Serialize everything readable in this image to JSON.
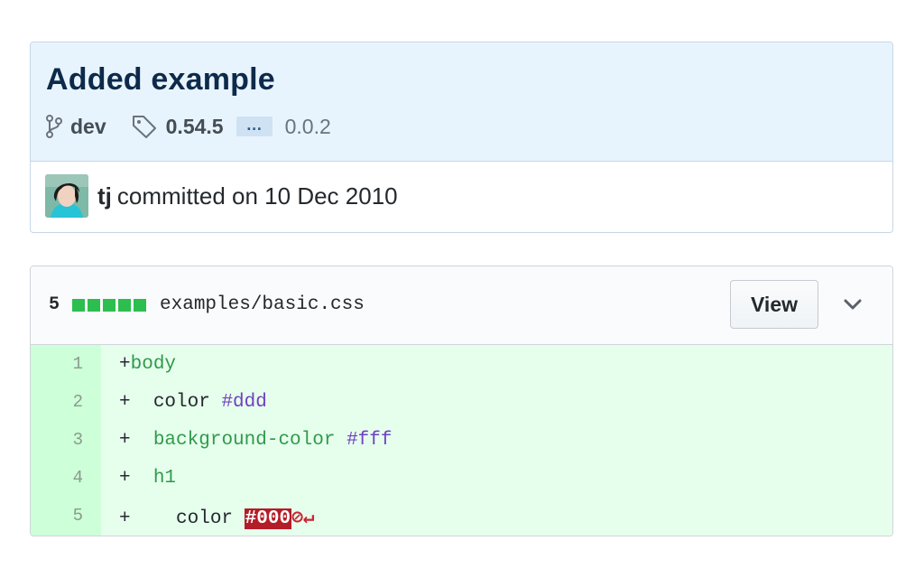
{
  "commit": {
    "title": "Added example",
    "branch": "dev",
    "tag_start": "0.54.5",
    "tag_ellipsis": "…",
    "tag_end": "0.0.2",
    "author": "tj",
    "committed_text": "committed on 10 Dec 2010"
  },
  "file": {
    "additions": "5",
    "diffstat_blocks": 5,
    "path": "examples/basic.css",
    "view_label": "View"
  },
  "diff": {
    "lines": [
      {
        "num": "1",
        "sign": "+",
        "tokens": [
          {
            "t": "body",
            "c": "green"
          }
        ]
      },
      {
        "num": "2",
        "sign": "+",
        "tokens": [
          {
            "t": "  color ",
            "c": "plain"
          },
          {
            "t": "#ddd",
            "c": "purple"
          }
        ]
      },
      {
        "num": "3",
        "sign": "+",
        "tokens": [
          {
            "t": "  ",
            "c": "plain"
          },
          {
            "t": "background-color",
            "c": "green"
          },
          {
            "t": " ",
            "c": "plain"
          },
          {
            "t": "#fff",
            "c": "purple"
          }
        ]
      },
      {
        "num": "4",
        "sign": "+",
        "tokens": [
          {
            "t": "  ",
            "c": "plain"
          },
          {
            "t": "h1",
            "c": "green"
          }
        ]
      },
      {
        "num": "5",
        "sign": "+",
        "tokens": [
          {
            "t": "    color ",
            "c": "plain"
          },
          {
            "t": "#000",
            "c": "err"
          },
          {
            "t": "⊘↵",
            "c": "red"
          }
        ]
      }
    ]
  },
  "icons": {
    "branch": "git-branch-icon",
    "tag": "tag-icon",
    "chevron": "chevron-down-icon"
  },
  "colors": {
    "header_bg": "#e8f4fd",
    "addition_bg": "#e6ffed",
    "addition_gutter": "#cdffd8",
    "diffstat_green": "#2cbe4e",
    "error_bg": "#b31d28"
  }
}
